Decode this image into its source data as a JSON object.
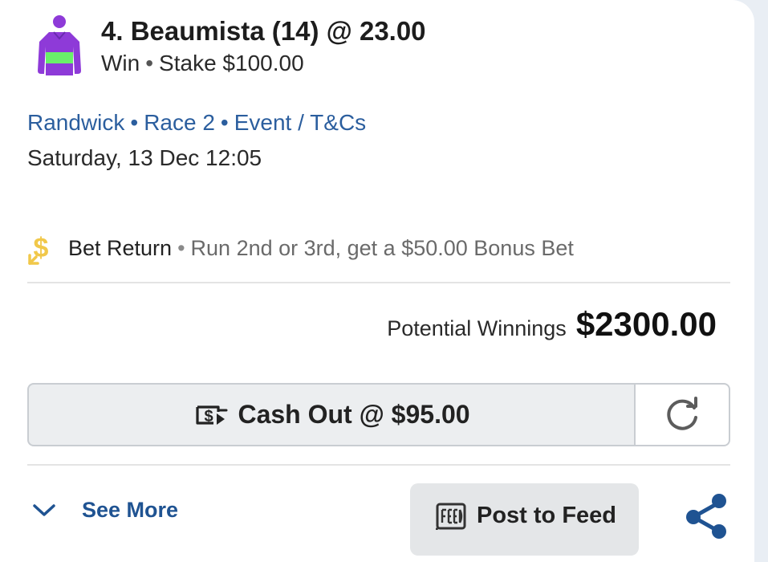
{
  "runner": {
    "title": "4. Beaumista (14) @ 23.00",
    "bet_type": "Win",
    "stake": "Stake $100.00",
    "silks_colors": {
      "body": "#8e3ad8",
      "band": "#69f06a",
      "cap": "#8e3ad8"
    }
  },
  "meeting": {
    "venue": "Randwick",
    "race": "Race 2",
    "event_link": "Event / T&Cs",
    "datetime": "Saturday, 13 Dec 12:05"
  },
  "promo": {
    "icon": "dollar-return-icon",
    "name": "Bet Return",
    "description": "Run 2nd or 3rd, get a $50.00 Bonus Bet"
  },
  "winnings": {
    "label": "Potential Winnings",
    "amount": "$2300.00"
  },
  "cashout": {
    "icon": "cash-out-icon",
    "label": "Cash Out @ $95.00",
    "refresh_icon": "refresh-icon"
  },
  "footer": {
    "see_more_label": "See More",
    "post_to_feed_label": "Post to Feed",
    "feed_icon": "feed-icon",
    "share_icon": "share-icon"
  },
  "colors": {
    "link_blue": "#2b5e9e",
    "see_more_blue": "#1f5392",
    "promo_gold": "#f1c84a",
    "share_blue": "#1f5392"
  },
  "separator": "•"
}
